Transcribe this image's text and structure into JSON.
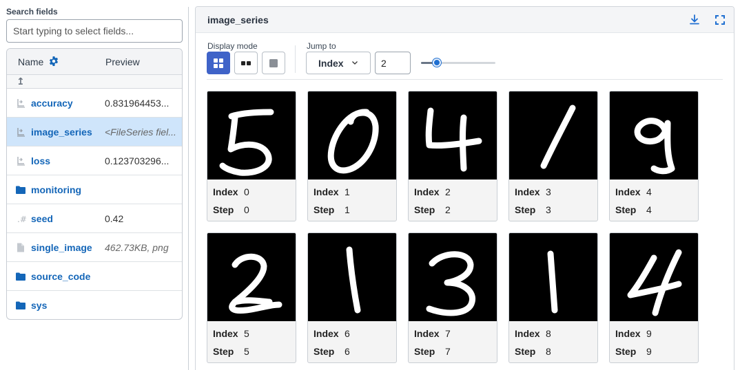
{
  "search": {
    "label": "Search fields",
    "placeholder": "Start typing to select fields..."
  },
  "table": {
    "col_name": "Name",
    "col_preview": "Preview"
  },
  "fields": [
    {
      "name": "accuracy",
      "preview": "0.831964453...",
      "icon": "float-series-icon",
      "italic": false,
      "selected": false
    },
    {
      "name": "image_series",
      "preview": "<FileSeries fiel...",
      "icon": "file-series-icon",
      "italic": true,
      "selected": true
    },
    {
      "name": "loss",
      "preview": "0.123703296...",
      "icon": "float-series-icon",
      "italic": false,
      "selected": false
    },
    {
      "name": "monitoring",
      "preview": "",
      "icon": "folder-icon",
      "italic": false,
      "selected": false
    },
    {
      "name": "seed",
      "preview": "0.42",
      "icon": "number-icon",
      "italic": false,
      "selected": false
    },
    {
      "name": "single_image",
      "preview": "462.73KB, png",
      "icon": "file-icon",
      "italic": true,
      "selected": false
    },
    {
      "name": "source_code",
      "preview": "",
      "icon": "folder-icon",
      "italic": false,
      "selected": false
    },
    {
      "name": "sys",
      "preview": "",
      "icon": "folder-icon",
      "italic": false,
      "selected": false
    }
  ],
  "panel": {
    "title": "image_series",
    "display_mode_label": "Display mode",
    "jump_to_label": "Jump to",
    "jump_select_value": "Index",
    "jump_input_value": "2",
    "slider_fraction": 0.22,
    "accent_color": "#3f63c8"
  },
  "images": [
    {
      "digit": "5",
      "index": "0",
      "step": "0"
    },
    {
      "digit": "0",
      "index": "1",
      "step": "1"
    },
    {
      "digit": "4",
      "index": "2",
      "step": "2"
    },
    {
      "digit": "1",
      "index": "3",
      "step": "3"
    },
    {
      "digit": "9",
      "index": "4",
      "step": "4"
    },
    {
      "digit": "2",
      "index": "5",
      "step": "5"
    },
    {
      "digit": "1",
      "index": "6",
      "step": "6"
    },
    {
      "digit": "3",
      "index": "7",
      "step": "7"
    },
    {
      "digit": "1",
      "index": "8",
      "step": "8"
    },
    {
      "digit": "4",
      "index": "9",
      "step": "9"
    }
  ],
  "card_labels": {
    "index": "Index",
    "step": "Step"
  }
}
